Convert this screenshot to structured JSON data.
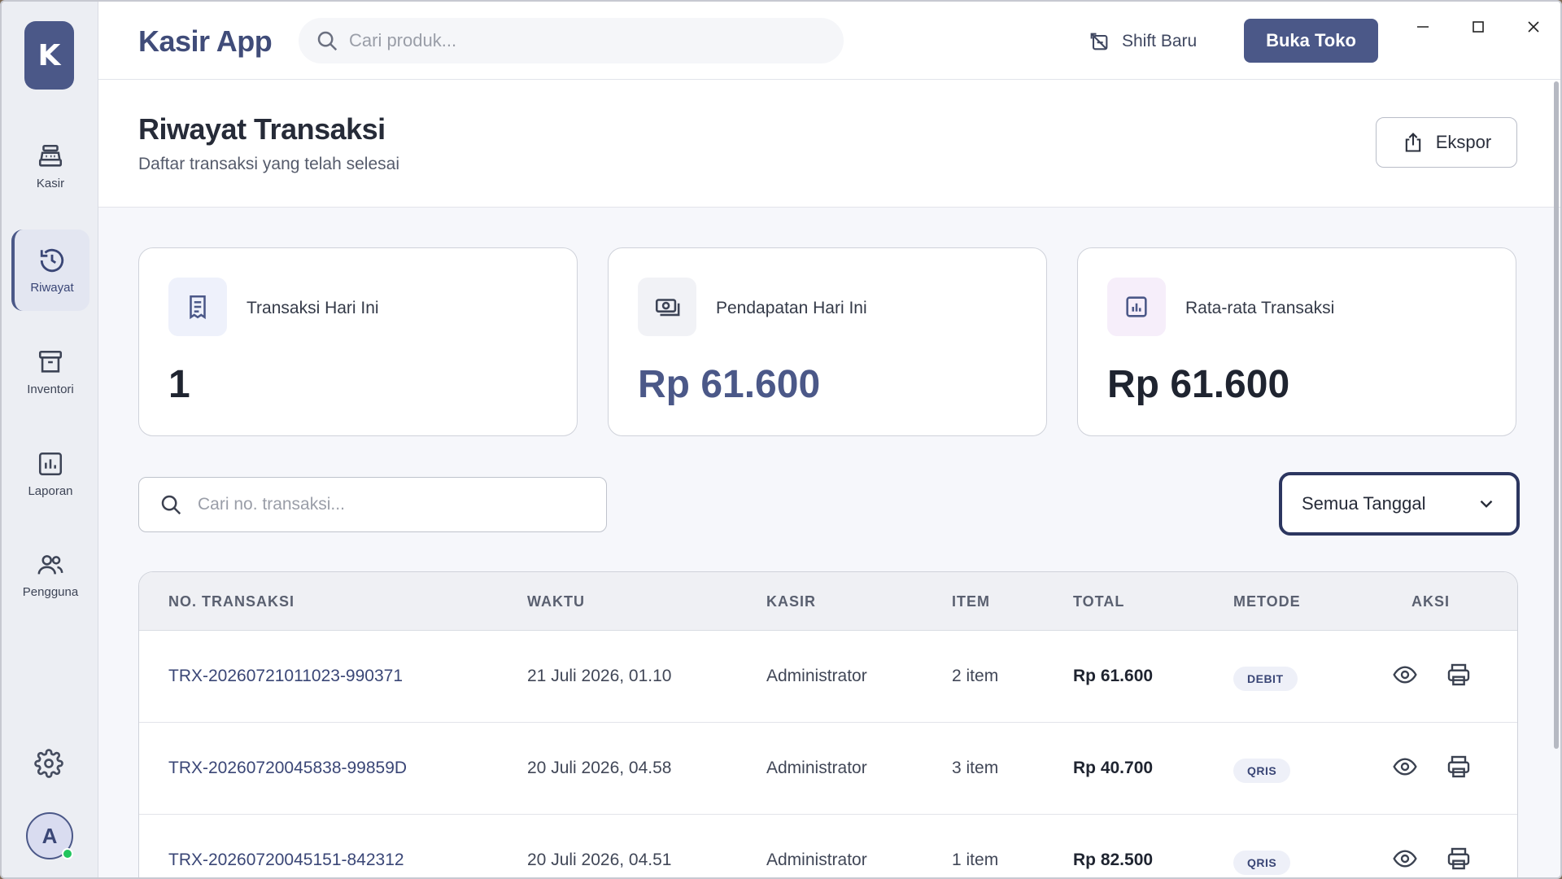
{
  "app": {
    "logo_letter": "K",
    "title": "Kasir App"
  },
  "topbar": {
    "search_placeholder": "Cari produk...",
    "shift_label": "Shift Baru",
    "open_store_label": "Buka Toko"
  },
  "sidebar": {
    "items": [
      {
        "label": "Kasir",
        "icon": "cash-register-icon"
      },
      {
        "label": "Riwayat",
        "icon": "history-icon",
        "active": true
      },
      {
        "label": "Inventori",
        "icon": "archive-box-icon"
      },
      {
        "label": "Laporan",
        "icon": "bar-chart-icon"
      },
      {
        "label": "Pengguna",
        "icon": "users-icon"
      }
    ],
    "avatar_letter": "A"
  },
  "header": {
    "title": "Riwayat Transaksi",
    "subtitle": "Daftar transaksi yang telah selesai",
    "export_label": "Ekspor"
  },
  "stats": [
    {
      "label": "Transaksi Hari Ini",
      "value": "1",
      "icon": "receipt-icon",
      "accent": "#eef1fb",
      "value_color": "#1f2430"
    },
    {
      "label": "Pendapatan Hari Ini",
      "value": "Rp 61.600",
      "icon": "cash-icon",
      "accent": "#f1f2f6",
      "value_color": "#4b5888"
    },
    {
      "label": "Rata-rata Transaksi",
      "value": "Rp 61.600",
      "icon": "report-chart-icon",
      "accent": "#f6eefa",
      "value_color": "#1f2430"
    }
  ],
  "filters": {
    "search_placeholder": "Cari no. transaksi...",
    "date_value": "Semua Tanggal"
  },
  "table": {
    "columns": [
      "NO. TRANSAKSI",
      "WAKTU",
      "KASIR",
      "ITEM",
      "TOTAL",
      "METODE",
      "AKSI"
    ],
    "rows": [
      {
        "id": "TRX-20260721011023-990371",
        "time": "21 Juli 2026, 01.10",
        "cashier": "Administrator",
        "items": "2 item",
        "total": "Rp 61.600",
        "method": "DEBIT"
      },
      {
        "id": "TRX-20260720045838-99859D",
        "time": "20 Juli 2026, 04.58",
        "cashier": "Administrator",
        "items": "3 item",
        "total": "Rp 40.700",
        "method": "QRIS"
      },
      {
        "id": "TRX-20260720045151-842312",
        "time": "20 Juli 2026, 04.51",
        "cashier": "Administrator",
        "items": "1 item",
        "total": "Rp 82.500",
        "method": "QRIS"
      }
    ]
  },
  "colors": {
    "primary": "#4b5888",
    "online": "#22c55e"
  }
}
